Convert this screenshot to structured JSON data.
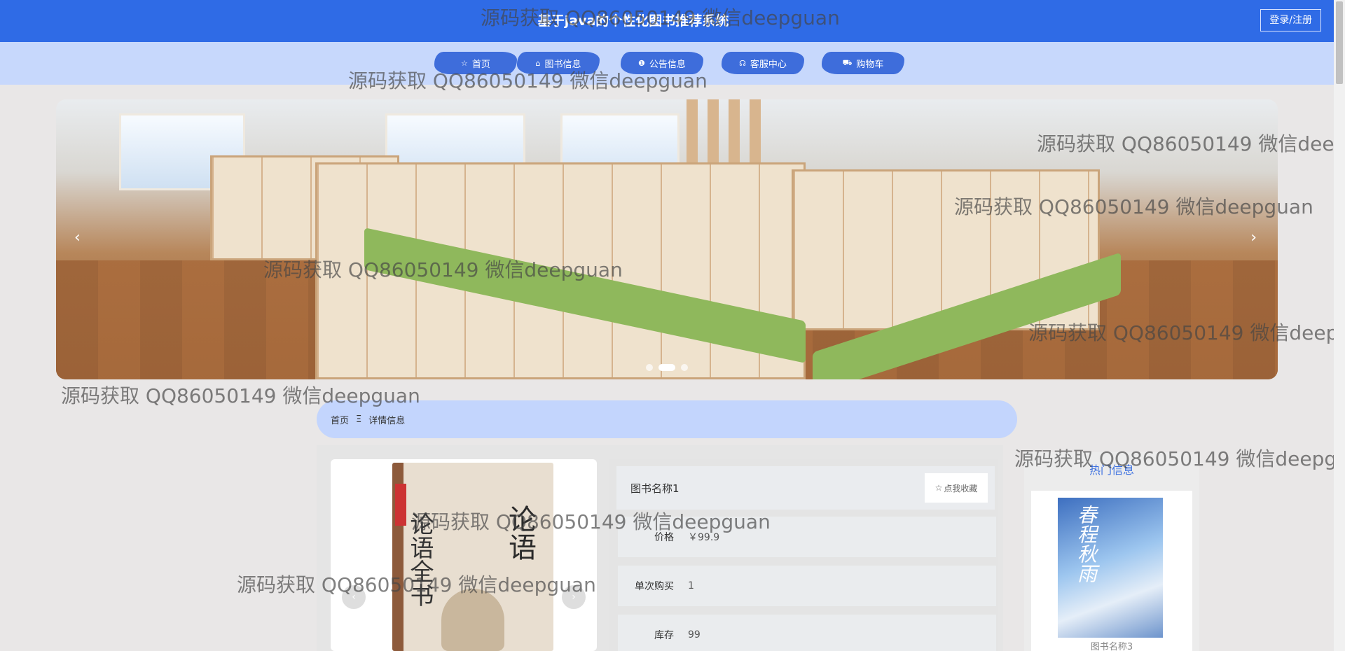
{
  "header": {
    "site_title": "基于java的个性化图书推荐系统",
    "login_label": "登录/注册"
  },
  "nav": {
    "items": [
      {
        "label": "首页",
        "icon": "star-icon",
        "glyph": "☆"
      },
      {
        "label": "图书信息",
        "icon": "bag-icon",
        "glyph": "⌂"
      },
      {
        "label": "公告信息",
        "icon": "info-icon",
        "glyph": "❶"
      },
      {
        "label": "客服中心",
        "icon": "headset-icon",
        "glyph": "☊"
      },
      {
        "label": "购物车",
        "icon": "cart-icon",
        "glyph": "⛟"
      }
    ]
  },
  "banner": {
    "prev": "‹",
    "next": "›",
    "dots": 3,
    "active_dot": 1
  },
  "breadcrumb": {
    "home": "首页",
    "separator": "Ξ",
    "current": "详情信息"
  },
  "detail": {
    "book_name": "图书名称1",
    "favorite_label": "点我收藏",
    "favorite_glyph": "☆",
    "image_prev": "‹",
    "image_next": "›",
    "cover_text_left": "论语全书",
    "cover_text_right": "论语",
    "fields": [
      {
        "label": "价格",
        "value": "￥99.9"
      },
      {
        "label": "单次购买",
        "value": "1"
      },
      {
        "label": "库存",
        "value": "99"
      }
    ]
  },
  "hot": {
    "title": "热门信息",
    "item_name": "图书名称3",
    "cover_text": "春程秋雨"
  },
  "watermark": {
    "text": "源码获取 QQ86050149 微信deepguan"
  }
}
